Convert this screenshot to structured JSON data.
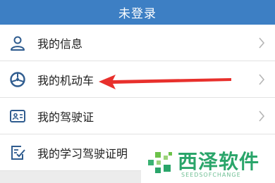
{
  "header": {
    "title": "未登录"
  },
  "menu": {
    "items": [
      {
        "label": "我的信息",
        "icon": "user-icon"
      },
      {
        "label": "我的机动车",
        "icon": "steering-wheel-icon"
      },
      {
        "label": "我的驾驶证",
        "icon": "id-card-icon"
      },
      {
        "label": "我的学习驾驶证明",
        "icon": "document-check-icon"
      }
    ]
  },
  "watermark": {
    "title": "西泽软件",
    "subtitle": "SEEDSOFCHANGE"
  },
  "colors": {
    "header_bg": "#3d7fc4",
    "icon_blue": "#2f5c8f",
    "arrow_red": "#e8302c",
    "watermark_green": "#2aa56a"
  }
}
